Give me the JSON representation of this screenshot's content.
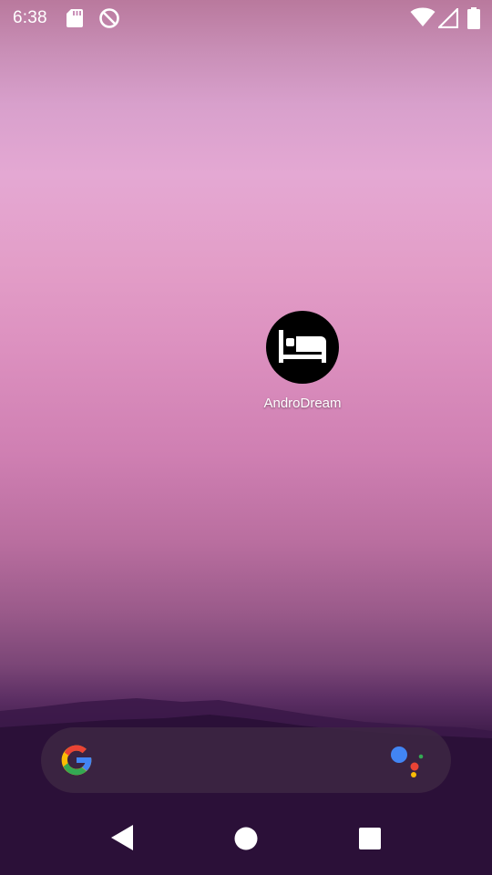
{
  "status_bar": {
    "time": "6:38",
    "icons": [
      "sd-card-icon",
      "do-not-disturb-icon",
      "wifi-icon",
      "cell-signal-icon",
      "battery-icon"
    ]
  },
  "home": {
    "app_shortcut": {
      "label": "AndroDream",
      "icon": "bed-icon"
    }
  },
  "search_bar": {
    "icons": [
      "google-g-icon",
      "google-assistant-icon"
    ]
  },
  "nav_bar": {
    "buttons": [
      "back-icon",
      "home-icon",
      "recents-icon"
    ]
  },
  "colors": {
    "google_blue": "#4285F4",
    "google_red": "#EA4335",
    "google_yellow": "#FBBC05",
    "google_green": "#34A853"
  }
}
